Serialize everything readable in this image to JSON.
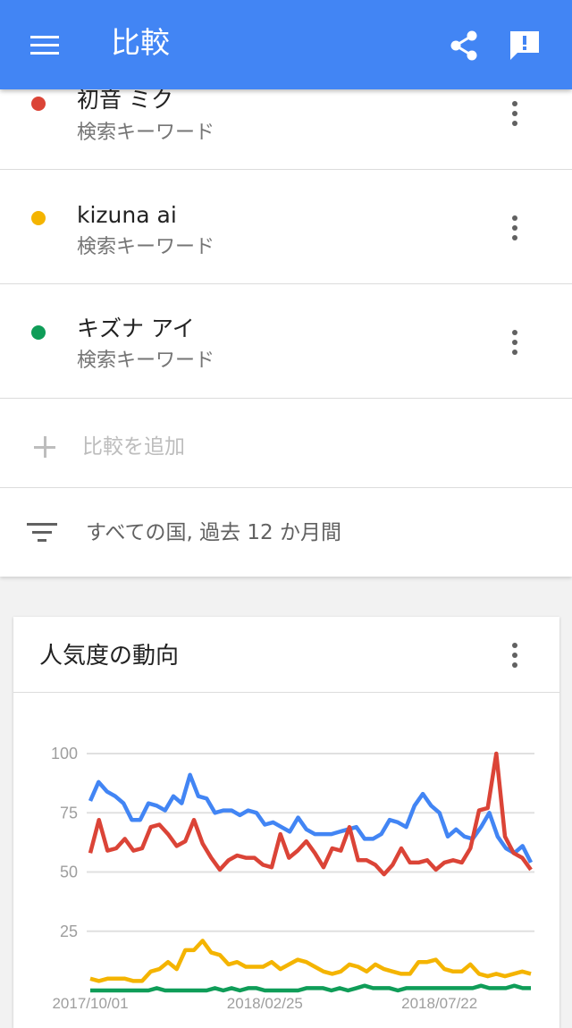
{
  "appbar": {
    "title": "比較"
  },
  "terms": [
    {
      "name": "初音 ミク",
      "type": "検索キーワード",
      "color": "#db4437"
    },
    {
      "name": "kizuna ai",
      "type": "検索キーワード",
      "color": "#f4b400"
    },
    {
      "name": "キズナ アイ",
      "type": "検索キーワード",
      "color": "#0f9d58"
    }
  ],
  "add_compare": "比較を追加",
  "filter": "すべての国, 過去 12 か月間",
  "card": {
    "title": "人気度の動向"
  },
  "chart_data": {
    "type": "line",
    "ylim": [
      0,
      100
    ],
    "yticks": [
      25,
      50,
      75,
      100
    ],
    "xtick_labels": [
      "2017/10/01",
      "2018/02/25",
      "2018/07/22"
    ],
    "xtick_index": [
      0,
      21,
      42
    ],
    "series": [
      {
        "color": "#4285f4",
        "values": [
          80,
          88,
          84,
          82,
          79,
          72,
          72,
          79,
          78,
          76,
          82,
          79,
          91,
          82,
          81,
          75,
          76,
          76,
          74,
          76,
          75,
          70,
          71,
          69,
          67,
          73,
          68,
          66,
          66,
          66,
          67,
          68,
          69,
          64,
          64,
          66,
          72,
          71,
          69,
          78,
          83,
          78,
          75,
          65,
          68,
          65,
          64,
          69,
          75,
          65,
          60,
          58,
          61,
          54
        ]
      },
      {
        "color": "#db4437",
        "values": [
          58,
          72,
          59,
          60,
          64,
          59,
          60,
          69,
          70,
          66,
          61,
          63,
          72,
          62,
          56,
          51,
          55,
          57,
          56,
          56,
          53,
          52,
          66,
          56,
          59,
          63,
          58,
          52,
          60,
          59,
          69,
          55,
          55,
          53,
          49,
          53,
          60,
          54,
          54,
          55,
          51,
          54,
          55,
          54,
          60,
          76,
          77,
          100,
          65,
          58,
          56,
          51
        ]
      },
      {
        "color": "#f4b400",
        "values": [
          5,
          4,
          5,
          5,
          5,
          4,
          4,
          8,
          9,
          12,
          9,
          17,
          17,
          21,
          16,
          15,
          11,
          12,
          10,
          10,
          10,
          12,
          9,
          11,
          13,
          12,
          10,
          8,
          7,
          8,
          11,
          10,
          8,
          11,
          9,
          8,
          7,
          7,
          12,
          12,
          13,
          9,
          8,
          8,
          11,
          7,
          6,
          7,
          6,
          7,
          8,
          7
        ]
      },
      {
        "color": "#0f9d58",
        "values": [
          0,
          0,
          0,
          0,
          0,
          0,
          0,
          0,
          1,
          0,
          0,
          0,
          0,
          0,
          0,
          1,
          0,
          1,
          0,
          1,
          1,
          0,
          0,
          0,
          0,
          0,
          1,
          1,
          1,
          0,
          1,
          0,
          1,
          2,
          1,
          1,
          1,
          0,
          1,
          1,
          1,
          1,
          1,
          1,
          1,
          1,
          1,
          2,
          1,
          1,
          1,
          2,
          1,
          1
        ]
      }
    ]
  }
}
